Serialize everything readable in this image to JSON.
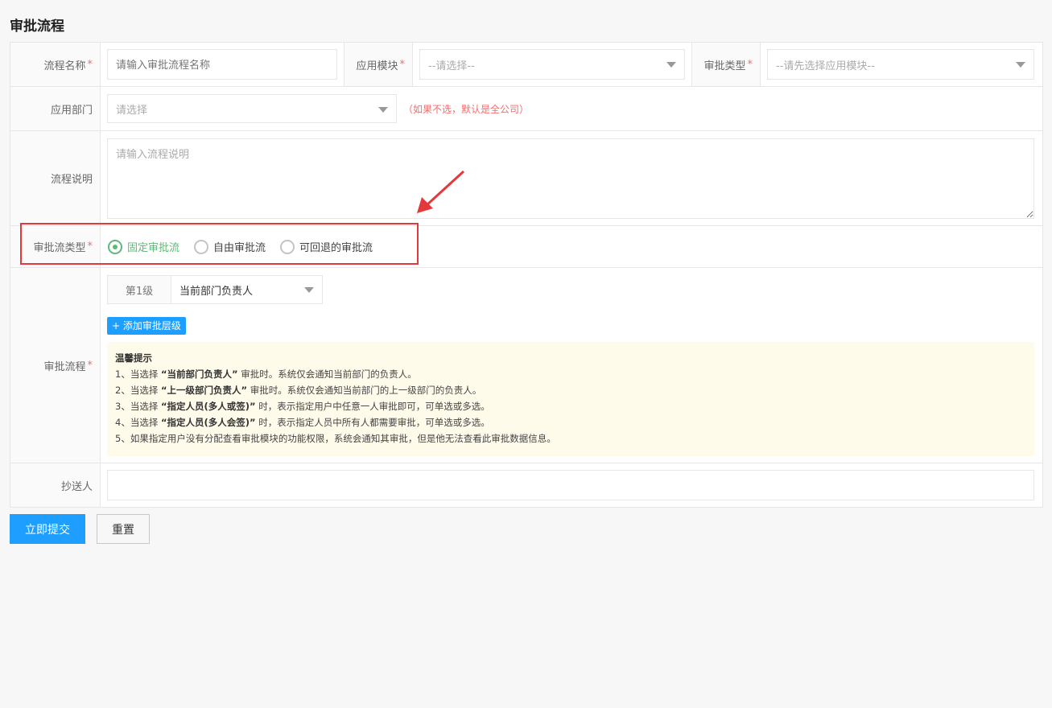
{
  "page": {
    "title": "审批流程"
  },
  "fields": {
    "name": {
      "label": "流程名称",
      "placeholder": "请输入审批流程名称"
    },
    "module": {
      "label": "应用模块",
      "value": "--请选择--"
    },
    "approval_type": {
      "label": "审批类型",
      "value": "--请先选择应用模块--"
    },
    "department": {
      "label": "应用部门",
      "value": "请选择",
      "hint": "（如果不选，默认是全公司）"
    },
    "description": {
      "label": "流程说明",
      "placeholder": "请输入流程说明"
    },
    "flow_type": {
      "label": "审批流类型",
      "options": [
        "固定审批流",
        "自由审批流",
        "可回退的审批流"
      ],
      "selected": "固定审批流"
    },
    "flow": {
      "label": "审批流程",
      "levels": [
        {
          "level": "第1级",
          "value": "当前部门负责人"
        }
      ],
      "add_label": "+ 添加审批层级",
      "tips": {
        "title": "温馨提示",
        "items": [
          {
            "pre": "1、当选择 ",
            "bold": "“当前部门负责人”",
            "post": " 审批时。系统仅会通知当前部门的负责人。"
          },
          {
            "pre": "2、当选择 ",
            "bold": "“上一级部门负责人”",
            "post": " 审批时。系统仅会通知当前部门的上一级部门的负责人。"
          },
          {
            "pre": "3、当选择 ",
            "bold": "“指定人员(多人或签)”",
            "post": " 时，表示指定用户中任意一人审批即可，可单选或多选。"
          },
          {
            "pre": "4、当选择 ",
            "bold": "“指定人员(多人会签)”",
            "post": " 时，表示指定人员中所有人都需要审批，可单选或多选。"
          },
          {
            "pre": "5、如果指定用户没有分配查看审批模块的功能权限，系统会通知其审批，但是他无法查看此审批数据信息。",
            "bold": "",
            "post": ""
          }
        ]
      }
    },
    "cc": {
      "label": "抄送人",
      "value": ""
    }
  },
  "buttons": {
    "submit": "立即提交",
    "reset": "重置"
  },
  "colors": {
    "primary": "#1e9fff",
    "selected_radio": "#5fb878",
    "required": "#f56c6c",
    "highlight_box": "#e4393c"
  }
}
